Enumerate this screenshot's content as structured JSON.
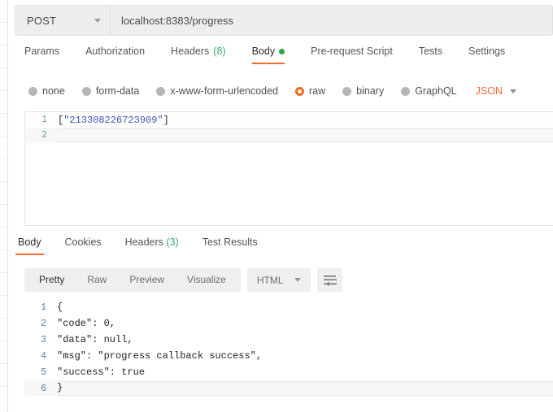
{
  "sidebar": {
    "row_count": 18
  },
  "request": {
    "method": "POST",
    "url": "localhost:8383/progress",
    "method_caret_icon": "chevron-down-icon",
    "tabs": [
      {
        "label": "Params",
        "active": false
      },
      {
        "label": "Authorization",
        "active": false
      },
      {
        "label": "Headers",
        "count": "(8)",
        "active": false
      },
      {
        "label": "Body",
        "active": true,
        "dot": "green-dot-icon"
      },
      {
        "label": "Pre-request Script",
        "active": false
      },
      {
        "label": "Tests",
        "active": false
      },
      {
        "label": "Settings",
        "active": false
      }
    ],
    "body_types": [
      {
        "label": "none",
        "selected": false
      },
      {
        "label": "form-data",
        "selected": false
      },
      {
        "label": "x-www-form-urlencoded",
        "selected": false
      },
      {
        "label": "raw",
        "selected": true
      },
      {
        "label": "binary",
        "selected": false
      },
      {
        "label": "GraphQL",
        "selected": false
      }
    ],
    "raw_format": "JSON",
    "raw_format_caret_icon": "chevron-down-icon",
    "editor": {
      "lines": [
        {
          "number": "1",
          "open_bracket": "[",
          "string": "\"213308226723909\"",
          "close_bracket": "]",
          "active": false
        },
        {
          "number": "2",
          "text": "",
          "active": true
        }
      ]
    }
  },
  "response": {
    "tabs": [
      {
        "label": "Body",
        "active": true
      },
      {
        "label": "Cookies",
        "active": false
      },
      {
        "label": "Headers",
        "count": "(3)",
        "active": false
      },
      {
        "label": "Test Results",
        "active": false
      }
    ],
    "view_modes": [
      {
        "label": "Pretty",
        "active": true
      },
      {
        "label": "Raw",
        "active": false
      },
      {
        "label": "Preview",
        "active": false
      },
      {
        "label": "Visualize",
        "active": false
      }
    ],
    "format": "HTML",
    "format_caret_icon": "chevron-down-icon",
    "wrap_icon": "word-wrap-icon",
    "body": {
      "lines": [
        {
          "number": "1",
          "text": "{",
          "active": false
        },
        {
          "number": "2",
          "text": "\"code\": 0,",
          "active": false
        },
        {
          "number": "3",
          "text": "\"data\": null,",
          "active": false
        },
        {
          "number": "4",
          "text": "\"msg\": \"progress callback success\",",
          "active": false
        },
        {
          "number": "5",
          "text": "\"success\": true",
          "active": false
        },
        {
          "number": "6",
          "text": "}",
          "active": true
        }
      ]
    }
  },
  "colors": {
    "accent": "#ef6c33",
    "selected_radio": "#f26b21",
    "count_green": "#3aa76d",
    "dot_green": "#2aa84a",
    "json_label": "#ef6c33",
    "string_blue": "#3a55b4",
    "gutter_blue": "#6a9fb5"
  }
}
